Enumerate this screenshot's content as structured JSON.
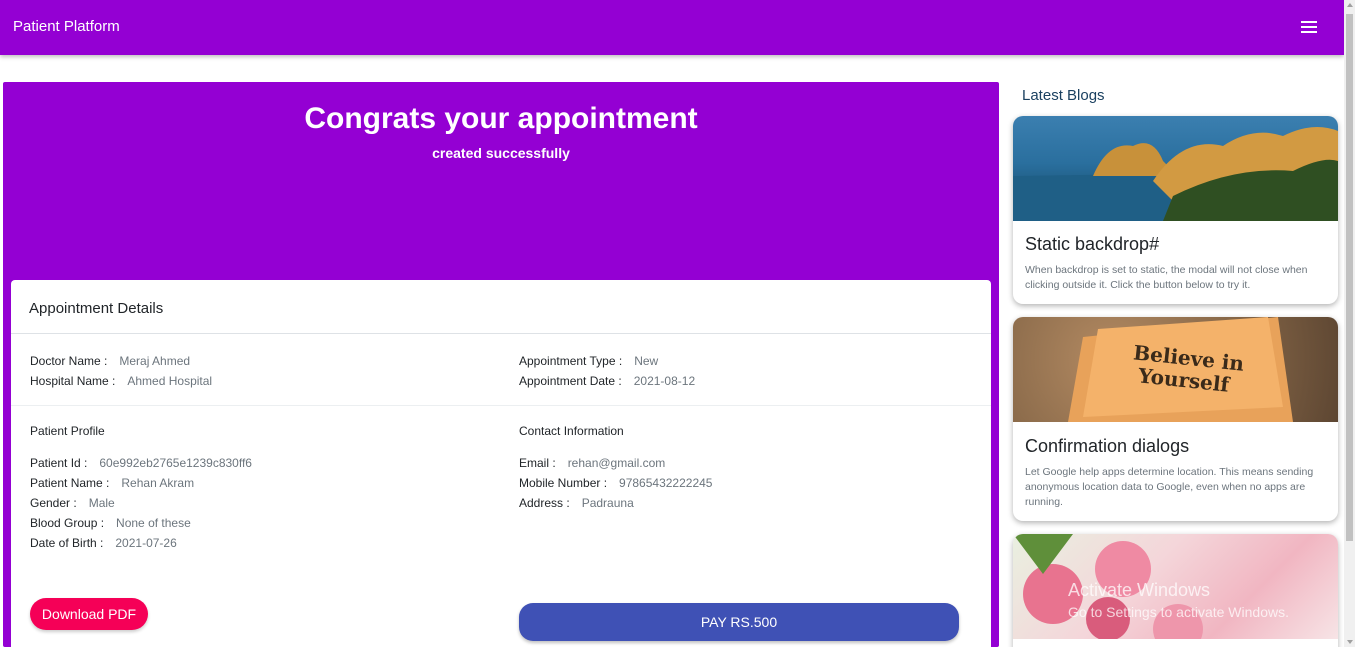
{
  "header": {
    "brand": "Patient Platform",
    "menu_icon": "hamburger-icon"
  },
  "hero": {
    "title": "Congrats your appointment",
    "subtitle": "created successfully"
  },
  "appointment": {
    "heading": "Appointment Details",
    "doctor_label": "Doctor Name :",
    "doctor_value": "Meraj Ahmed",
    "hospital_label": "Hospital Name :",
    "hospital_value": "Ahmed Hospital",
    "type_label": "Appointment Type :",
    "type_value": "New",
    "date_label": "Appointment Date :",
    "date_value": "2021-08-12"
  },
  "patient": {
    "heading": "Patient Profile",
    "id_label": "Patient Id :",
    "id_value": "60e992eb2765e1239c830ff6",
    "name_label": "Patient Name :",
    "name_value": "Rehan Akram",
    "gender_label": "Gender :",
    "gender_value": "Male",
    "blood_label": "Blood Group :",
    "blood_value": "None of these",
    "dob_label": "Date of Birth :",
    "dob_value": "2021-07-26"
  },
  "contact": {
    "heading": "Contact Information",
    "email_label": "Email :",
    "email_value": "rehan@gmail.com",
    "mobile_label": "Mobile Number :",
    "mobile_value": "97865432222245",
    "address_label": "Address :",
    "address_value": "Padrauna"
  },
  "actions": {
    "download": "Download PDF",
    "pay": "PAY RS.500"
  },
  "blogs": {
    "heading": "Latest Blogs",
    "items": [
      {
        "title": "Static backdrop#",
        "text": "When backdrop is set to static, the modal will not close when clicking outside it. Click the button below to try it."
      },
      {
        "title": "Confirmation dialogs",
        "text": "Let Google help apps determine location. This means sending anonymous location data to Google, even when no apps are running."
      },
      {
        "title": "",
        "text": ""
      }
    ]
  },
  "note_image_text": [
    "Believe in",
    "Yourself"
  ],
  "watermark": {
    "line1": "Activate Windows",
    "line2": "Go to Settings to activate Windows."
  },
  "colors": {
    "primary": "#9400d3",
    "pay": "#3f51b5",
    "download": "#f50057"
  }
}
